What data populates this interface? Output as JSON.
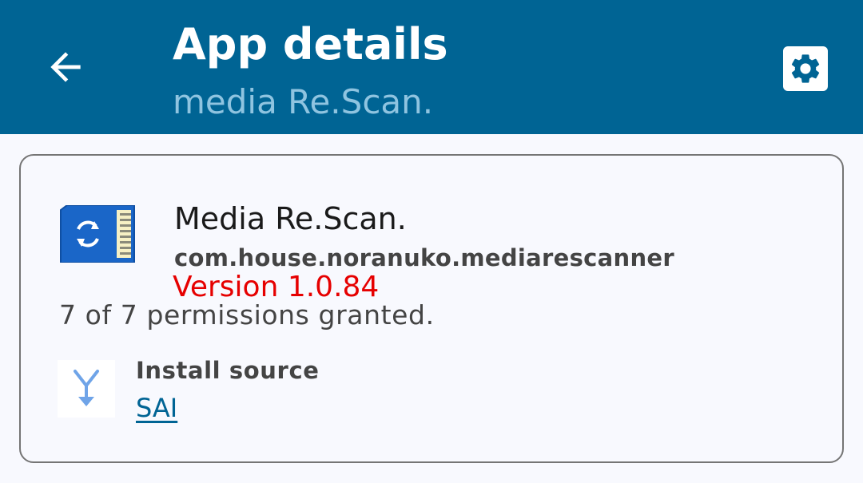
{
  "header": {
    "title": "App details",
    "subtitle": "media Re.Scan.",
    "back_icon": "arrow-left-icon",
    "settings_icon": "gear-icon",
    "background_color": "#006494"
  },
  "app": {
    "name": "Media Re.Scan.",
    "package": "com.house.noranuko.mediarescanner",
    "version": "Version 1.0.84",
    "version_color": "#e60000",
    "permissions": "7 of 7 permissions granted.",
    "icon": "sd-card-sync-icon"
  },
  "install_source": {
    "label": "Install source",
    "value": "SAI",
    "icon": "merge-arrow-icon"
  }
}
